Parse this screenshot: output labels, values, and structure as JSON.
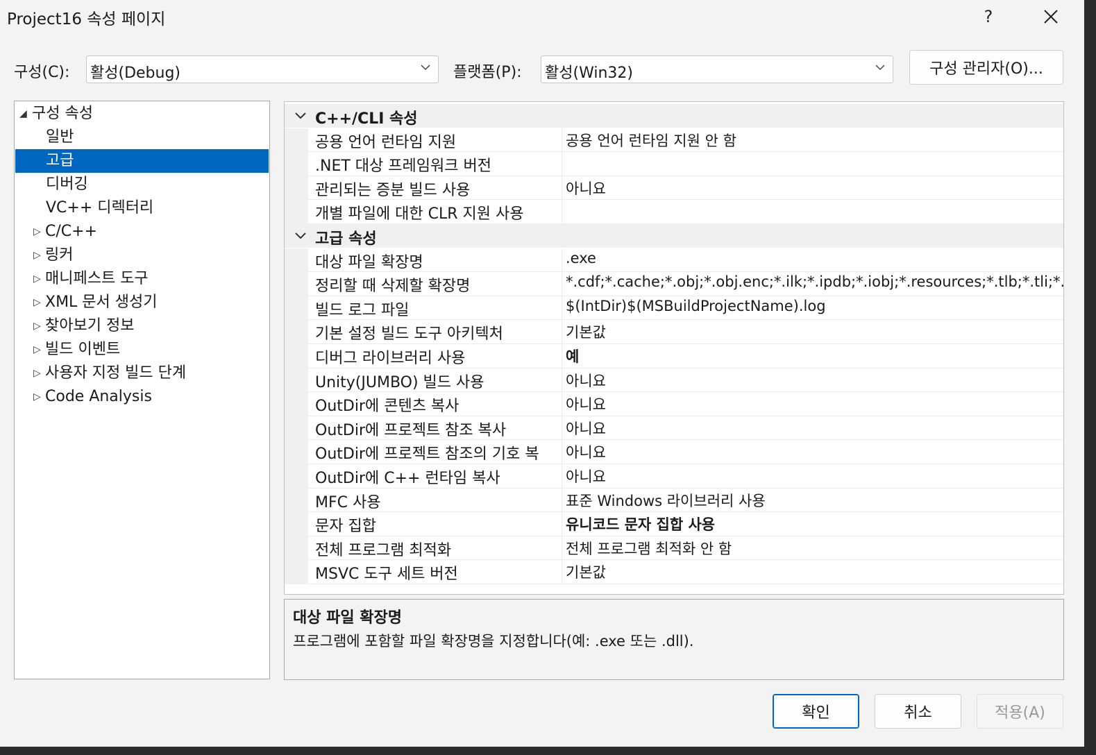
{
  "window": {
    "title": "Project16 속성 페이지",
    "help_label": "?",
    "close_label": "✕"
  },
  "config": {
    "config_label": "구성(C):",
    "config_value": "활성(Debug)",
    "platform_label": "플랫폼(P):",
    "platform_value": "활성(Win32)",
    "manager_button": "구성 관리자(O)..."
  },
  "tree": {
    "items": [
      {
        "label": "구성 속성",
        "arrow": "◢",
        "level": 0
      },
      {
        "label": "일반",
        "arrow": "",
        "level": 1
      },
      {
        "label": "고급",
        "arrow": "",
        "level": 1,
        "selected": true
      },
      {
        "label": "디버깅",
        "arrow": "",
        "level": 1
      },
      {
        "label": "VC++ 디렉터리",
        "arrow": "",
        "level": 1
      },
      {
        "label": "C/C++",
        "arrow": "▷",
        "level": 1
      },
      {
        "label": "링커",
        "arrow": "▷",
        "level": 1
      },
      {
        "label": "매니페스트 도구",
        "arrow": "▷",
        "level": 1
      },
      {
        "label": "XML 문서 생성기",
        "arrow": "▷",
        "level": 1
      },
      {
        "label": "찾아보기 정보",
        "arrow": "▷",
        "level": 1
      },
      {
        "label": "빌드 이벤트",
        "arrow": "▷",
        "level": 1
      },
      {
        "label": "사용자 지정 빌드 단계",
        "arrow": "▷",
        "level": 1
      },
      {
        "label": "Code Analysis",
        "arrow": "▷",
        "level": 1
      }
    ]
  },
  "grid": {
    "sections": [
      {
        "label": "C++/CLI 속성",
        "rows": [
          {
            "name": "공용 언어 런타임 지원",
            "value": "공용 언어 런타임 지원 안 함"
          },
          {
            "name": ".NET 대상 프레임워크 버전",
            "value": ""
          },
          {
            "name": "관리되는 증분 빌드 사용",
            "value": "아니요"
          },
          {
            "name": "개별 파일에 대한 CLR 지원 사용",
            "value": ""
          }
        ]
      },
      {
        "label": "고급 속성",
        "rows": [
          {
            "name": "대상 파일 확장명",
            "value": ".exe",
            "selected": true
          },
          {
            "name": "정리할 때 삭제할 확장명",
            "value": "*.cdf;*.cache;*.obj;*.obj.enc;*.ilk;*.ipdb;*.iobj;*.resources;*.tlb;*.tli;*.tlh;*"
          },
          {
            "name": "빌드 로그 파일",
            "value": "$(IntDir)$(MSBuildProjectName).log"
          },
          {
            "name": "기본 설정 빌드 도구 아키텍처",
            "value": "기본값"
          },
          {
            "name": "디버그 라이브러리 사용",
            "value": "예",
            "bold": true
          },
          {
            "name": "Unity(JUMBO) 빌드 사용",
            "value": "아니요"
          },
          {
            "name": "OutDir에 콘텐츠 복사",
            "value": "아니요"
          },
          {
            "name": "OutDir에 프로젝트 참조 복사",
            "value": "아니요"
          },
          {
            "name": "OutDir에 프로젝트 참조의 기호 복",
            "value": "아니요"
          },
          {
            "name": "OutDir에 C++ 런타임 복사",
            "value": "아니요"
          },
          {
            "name": "MFC 사용",
            "value": "표준 Windows 라이브러리 사용"
          },
          {
            "name": "문자 집합",
            "value": "유니코드 문자 집합 사용",
            "bold": true
          },
          {
            "name": "전체 프로그램 최적화",
            "value": "전체 프로그램 최적화 안 함"
          },
          {
            "name": "MSVC 도구 세트 버전",
            "value": "기본값"
          }
        ]
      }
    ]
  },
  "description": {
    "title": "대상 파일 확장명",
    "text": "프로그램에 포함할 파일 확장명을 지정합니다(예: .exe 또는 .dll)."
  },
  "buttons": {
    "ok": "확인",
    "cancel": "취소",
    "apply": "적용(A)"
  },
  "colors": {
    "accent": "#0067c0",
    "window_bg": "#f3f3f3"
  }
}
